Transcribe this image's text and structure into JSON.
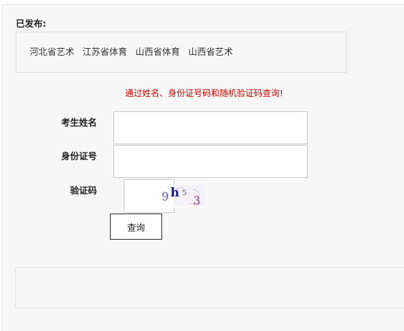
{
  "published": {
    "title": "已发布:",
    "items": [
      {
        "label": "河北省艺术"
      },
      {
        "label": "江苏省体育"
      },
      {
        "label": "山西省体育"
      },
      {
        "label": "山西省艺术"
      }
    ]
  },
  "form": {
    "notice": "通过姓名、身份证号码和随机验证码查询!",
    "name_label": "考生姓名",
    "name_value": "",
    "id_label": "身份证号",
    "id_value": "",
    "captcha_label": "验证码",
    "captcha_value": "",
    "captcha_text": "9h53",
    "submit_label": "查询"
  }
}
